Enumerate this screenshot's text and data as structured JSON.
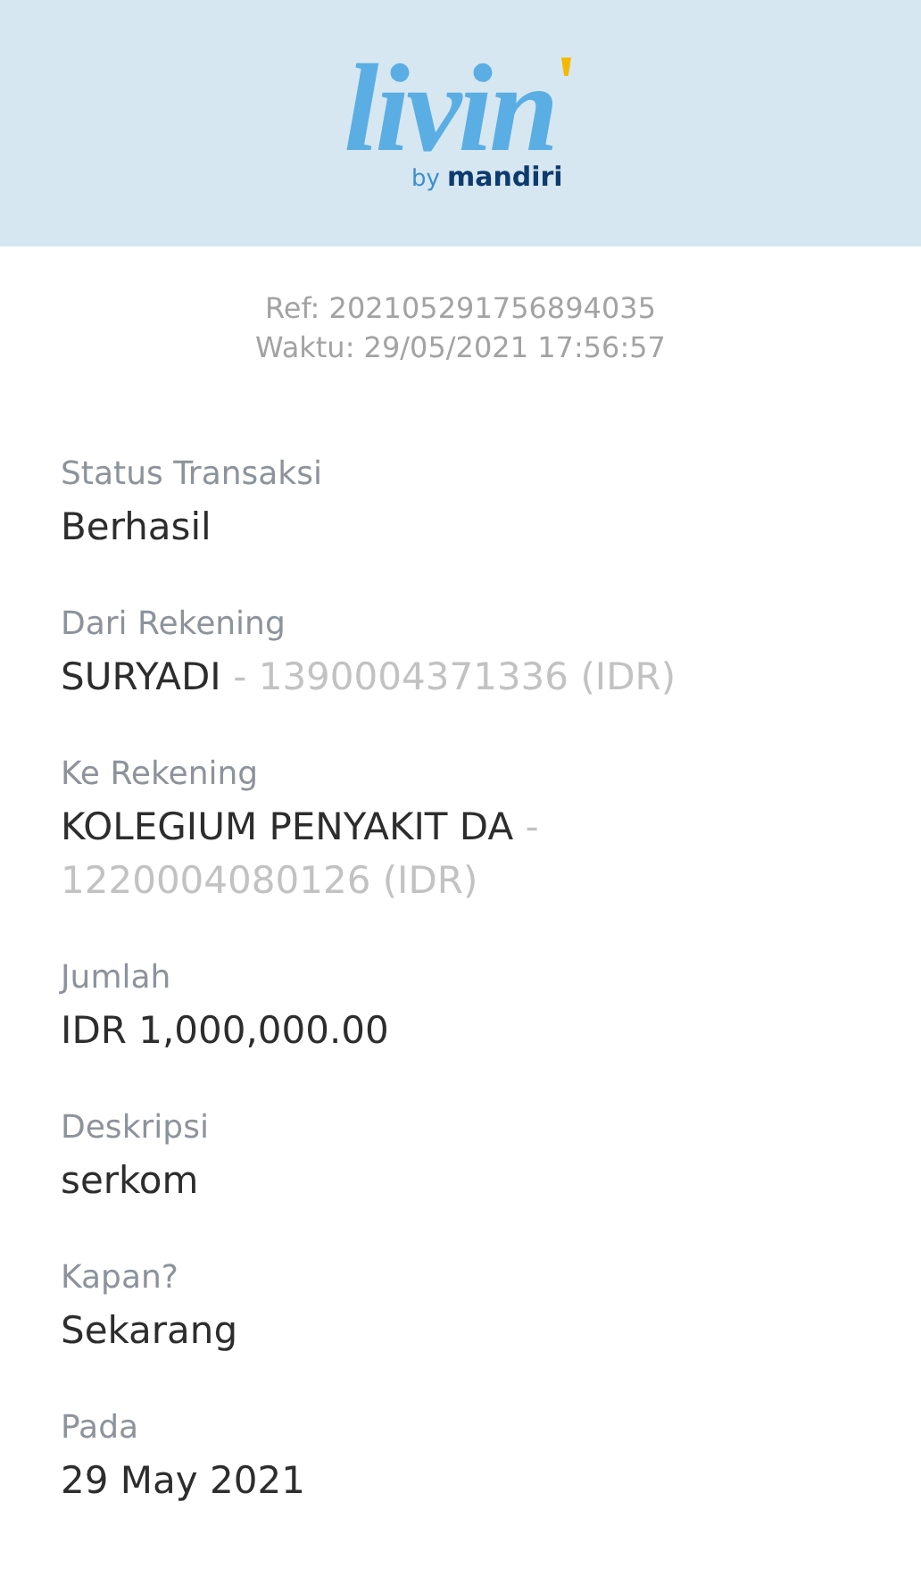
{
  "header": {
    "logo_word": "livin",
    "logo_accent": "'",
    "logo_by": "by",
    "logo_brand": "mandiri"
  },
  "receipt": {
    "ref": "Ref: 202105291756894035",
    "time": "Waktu: 29/05/2021 17:56:57"
  },
  "fields": [
    {
      "label": "Status Transaksi",
      "value": "Berhasil"
    },
    {
      "label": "Dari Rekening",
      "value": "SURYADI",
      "detail": "- 1390004371336 (IDR)"
    },
    {
      "label": "Ke Rekening",
      "value": "KOLEGIUM PENYAKIT DA",
      "detail": "- 1220004080126 (IDR)"
    },
    {
      "label": "Jumlah",
      "value": "IDR 1,000,000.00"
    },
    {
      "label": "Deskripsi",
      "value": "serkom"
    },
    {
      "label": "Kapan?",
      "value": "Sekarang"
    },
    {
      "label": "Pada",
      "value": "29 May 2021"
    }
  ]
}
